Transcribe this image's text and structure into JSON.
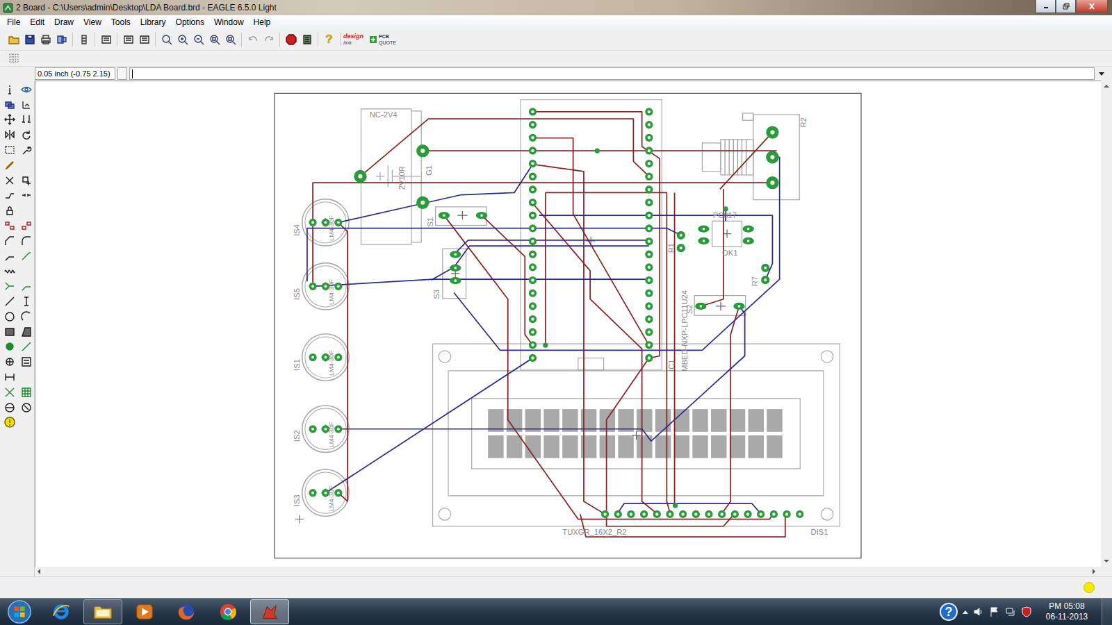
{
  "window": {
    "title": "2 Board - C:\\Users\\admin\\Desktop\\LDA Board.brd - EAGLE 6.5.0 Light"
  },
  "menu": [
    "File",
    "Edit",
    "Draw",
    "View",
    "Tools",
    "Library",
    "Options",
    "Window",
    "Help"
  ],
  "toolbar": {
    "help": "?",
    "logos": [
      {
        "line1": "design",
        "line2": "link"
      },
      {
        "line1": "PCB",
        "line2": "QUOTE"
      }
    ]
  },
  "command": {
    "coordinates": "0.05 inch (-0.75 2.15)",
    "value": ""
  },
  "board": {
    "labels": [
      {
        "text": "NC-2V4"
      },
      {
        "text": "2V10R"
      },
      {
        "text": "G1"
      },
      {
        "text": "S1"
      },
      {
        "text": "S3"
      },
      {
        "text": "IS4"
      },
      {
        "text": "IS5"
      },
      {
        "text": "IS1"
      },
      {
        "text": "IS2"
      },
      {
        "text": "IS3"
      },
      {
        "text": "LM4-30F"
      },
      {
        "text": "LM4-30F"
      },
      {
        "text": "LM4-30F"
      },
      {
        "text": "LM4-30F"
      },
      {
        "text": "LM4-30F"
      },
      {
        "text": "R2"
      },
      {
        "text": "R1"
      },
      {
        "text": "R7"
      },
      {
        "text": "PC817"
      },
      {
        "text": "OK1"
      },
      {
        "text": "S2"
      },
      {
        "text": "MBED-NXP-LPC11U24"
      },
      {
        "text": "IC1"
      },
      {
        "text": "TUXGR_16X2_R2"
      },
      {
        "text": "DIS1"
      }
    ]
  },
  "taskbar": {
    "apps": [
      {
        "kind": "ie",
        "running": false,
        "active": false
      },
      {
        "kind": "folder",
        "running": true,
        "active": false
      },
      {
        "kind": "media",
        "running": false,
        "active": false
      },
      {
        "kind": "firefox",
        "running": false,
        "active": false
      },
      {
        "kind": "chrome",
        "running": false,
        "active": false
      },
      {
        "kind": "eagle",
        "running": true,
        "active": true
      }
    ],
    "help": "?",
    "time": "PM 05:08",
    "date": "06-11-2013"
  }
}
